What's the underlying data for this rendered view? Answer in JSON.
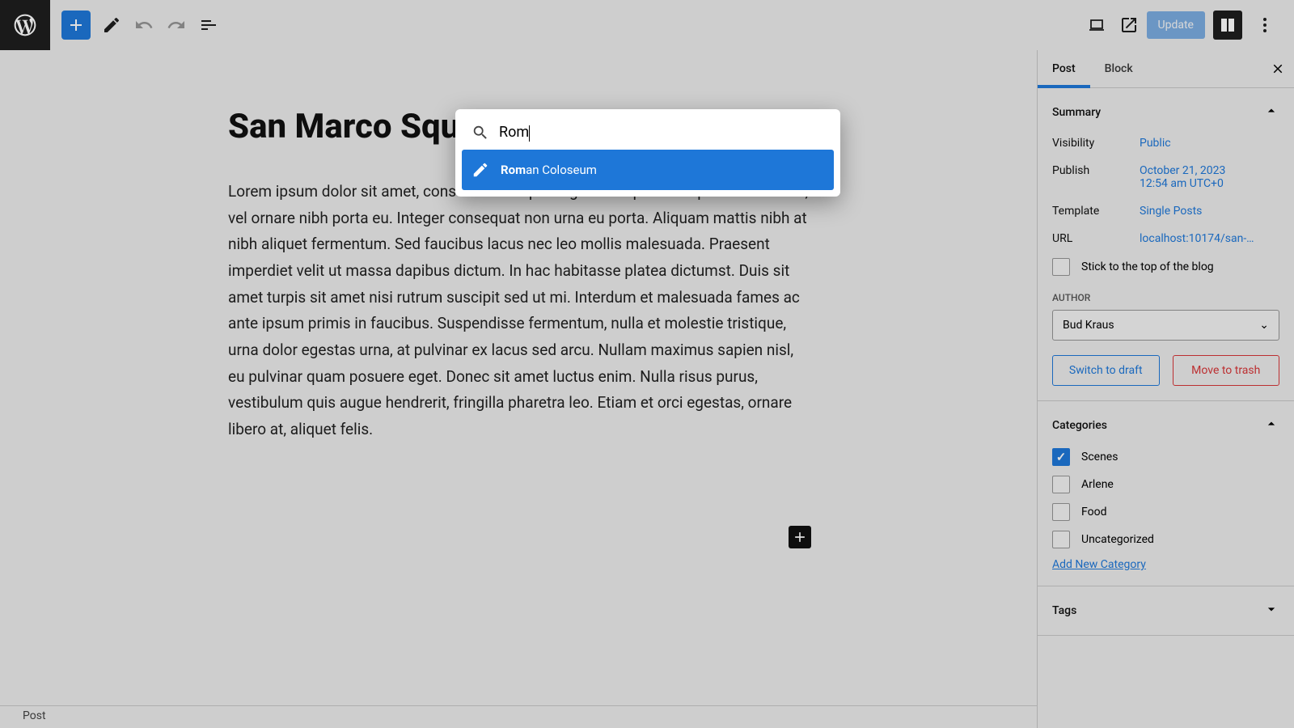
{
  "toolbar": {
    "update": "Update"
  },
  "tabs": {
    "post": "Post",
    "block": "Block"
  },
  "post": {
    "title": "San Marco Squ",
    "body": "Lorem ipsum dolor sit amet, consectetur adipiscing elit. Aliquam tempus libero tellus, vel ornare nibh porta eu. Integer consequat non urna eu porta. Aliquam mattis nibh at nibh aliquet fermentum. Sed faucibus lacus nec leo mollis malesuada. Praesent imperdiet velit ut massa dapibus dictum. In hac habitasse platea dictumst. Duis sit amet turpis sit amet nisi rutrum suscipit sed ut mi. Interdum et malesuada fames ac ante ipsum primis in faucibus. Suspendisse fermentum, nulla et molestie tristique, urna dolor egestas urna, at pulvinar ex lacus sed arcu. Nullam maximus sapien nisl, eu pulvinar quam posuere eget. Donec sit amet luctus enim. Nulla risus purus, vestibulum quis augue hendrerit, fringilla pharetra leo. Etiam et orci egestas, ornare libero at, aliquet felis."
  },
  "search": {
    "value": "Rom",
    "match_bold": "Rom",
    "match_rest": "an Coloseum"
  },
  "summary": {
    "title": "Summary",
    "visibility": {
      "k": "Visibility",
      "v": "Public"
    },
    "publish": {
      "k": "Publish",
      "v1": "October 21, 2023",
      "v2": "12:54 am UTC+0"
    },
    "template": {
      "k": "Template",
      "v": "Single Posts"
    },
    "url": {
      "k": "URL",
      "v": "localhost:10174/san-…"
    },
    "stick": "Stick to the top of the blog",
    "author_label": "AUTHOR",
    "author": "Bud Kraus",
    "draft": "Switch to draft",
    "trash": "Move to trash"
  },
  "categories": {
    "title": "Categories",
    "items": [
      {
        "label": "Scenes",
        "checked": true
      },
      {
        "label": "Arlene",
        "checked": false
      },
      {
        "label": "Food",
        "checked": false
      },
      {
        "label": "Uncategorized",
        "checked": false
      }
    ],
    "add": "Add New Category"
  },
  "tags": {
    "title": "Tags"
  },
  "footer": "Post"
}
